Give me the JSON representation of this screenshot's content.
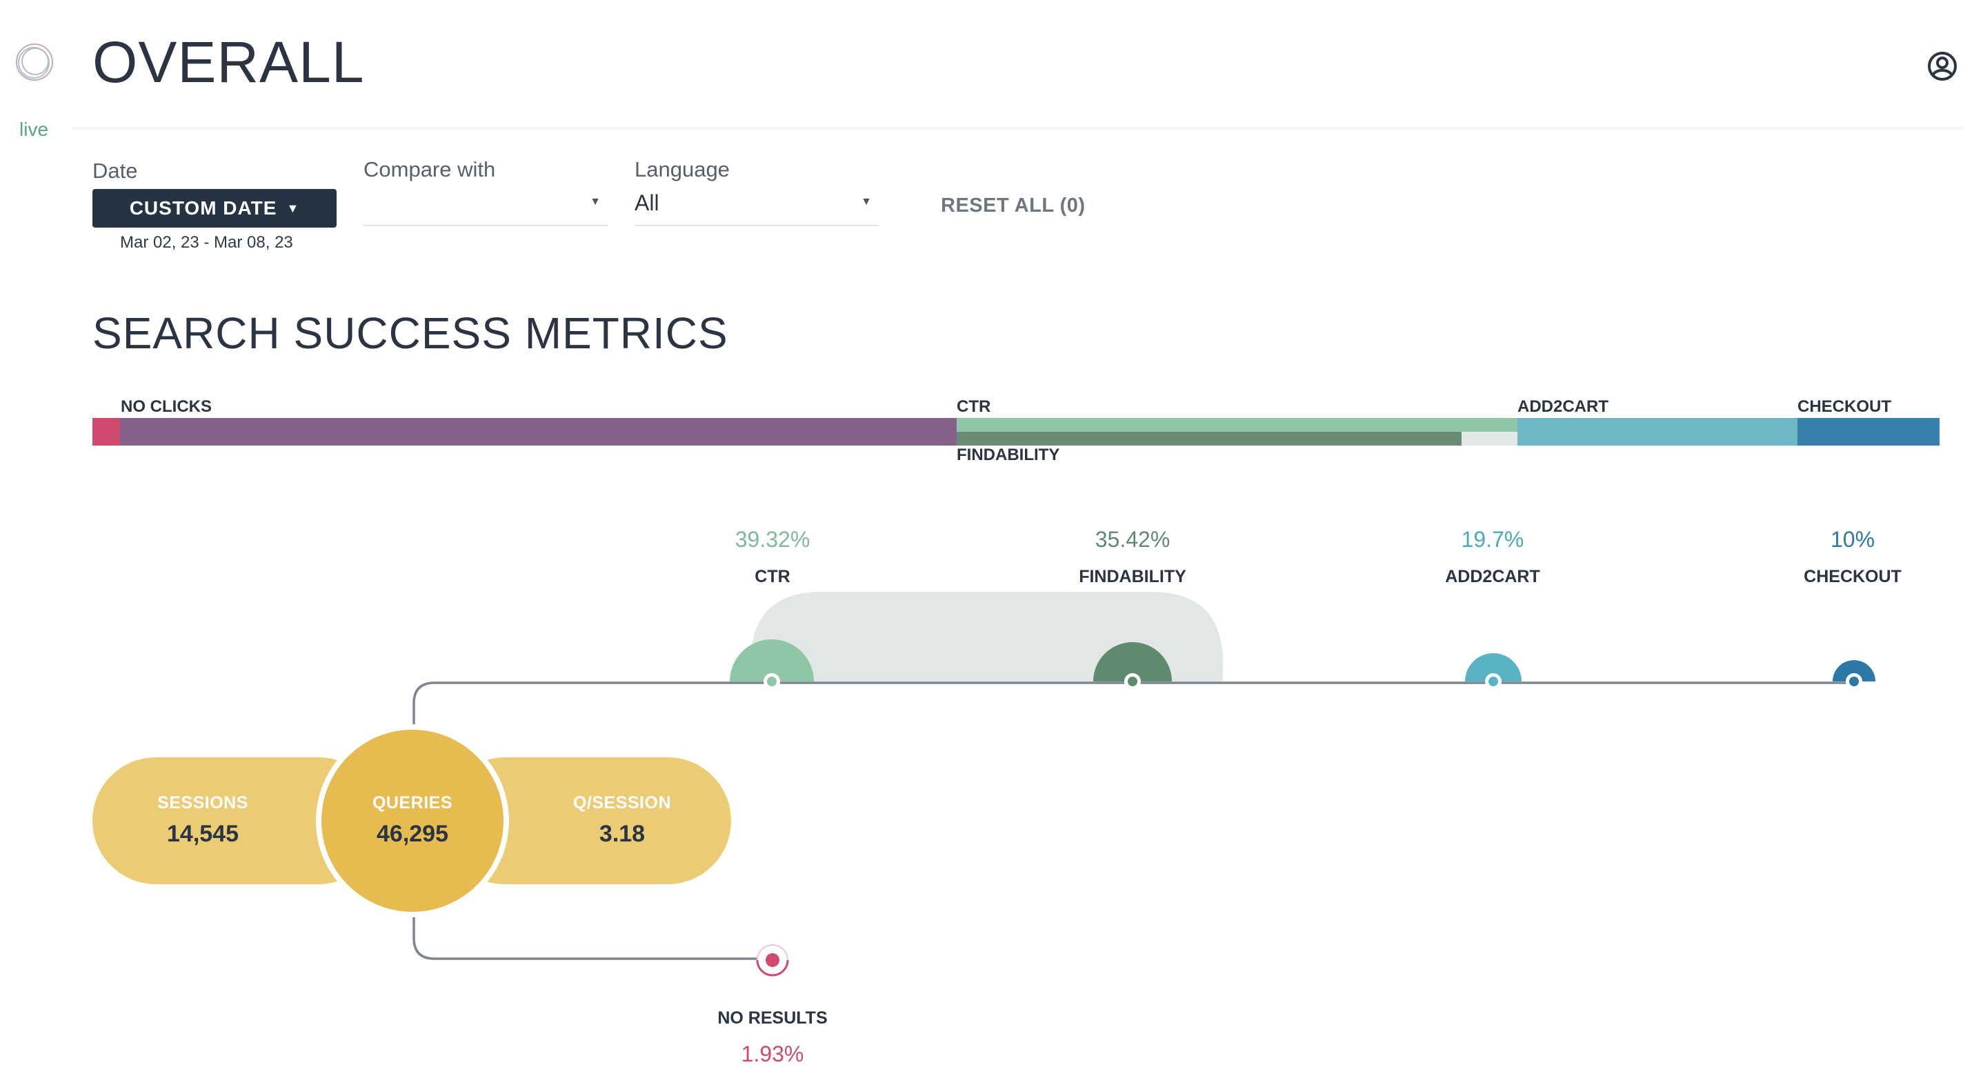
{
  "sidebar": {
    "status_label": "live"
  },
  "header": {
    "title": "OVERALL"
  },
  "filters": {
    "date": {
      "label": "Date",
      "button_label": "CUSTOM DATE",
      "range": "Mar 02, 23 - Mar 08, 23"
    },
    "compare": {
      "label": "Compare with",
      "value": ""
    },
    "language": {
      "label": "Language",
      "value": "All"
    },
    "reset_label": "RESET ALL (0)"
  },
  "section": {
    "title": "SEARCH SUCCESS METRICS"
  },
  "bar_labels": {
    "no_clicks": "NO CLICKS",
    "ctr": "CTR",
    "findability": "FINDABILITY",
    "add2cart": "ADD2CART",
    "checkout": "CHECKOUT"
  },
  "metrics": [
    {
      "key": "ctr",
      "name": "CTR",
      "value": "39.32%",
      "color": "#86c1a0"
    },
    {
      "key": "findability",
      "name": "FINDABILITY",
      "value": "35.42%",
      "color": "#5e8a6e"
    },
    {
      "key": "add2cart",
      "name": "ADD2CART",
      "value": "19.7%",
      "color": "#5ab3c4"
    },
    {
      "key": "checkout",
      "name": "CHECKOUT",
      "value": "10%",
      "color": "#2c79a8"
    }
  ],
  "traffic": {
    "sessions": {
      "label": "SESSIONS",
      "value": "14,545"
    },
    "queries": {
      "label": "QUERIES",
      "value": "46,295"
    },
    "q_per_session": {
      "label": "Q/SESSION",
      "value": "3.18"
    }
  },
  "no_results": {
    "name": "NO RESULTS",
    "value": "1.93%",
    "color": "#d04a6e"
  },
  "colors": {
    "no_results": "#d04a6e",
    "no_clicks": "#85628a",
    "ctr": "#8fc6a5",
    "findability": "#6b8c74",
    "findability_gap": "#e3e7e5",
    "add2cart": "#6db7c6",
    "checkout": "#377fad",
    "gold": "#e6bb4f",
    "gold_light": "#ebcb73",
    "connector": "#7d868f",
    "dark_button": "#253442"
  }
}
